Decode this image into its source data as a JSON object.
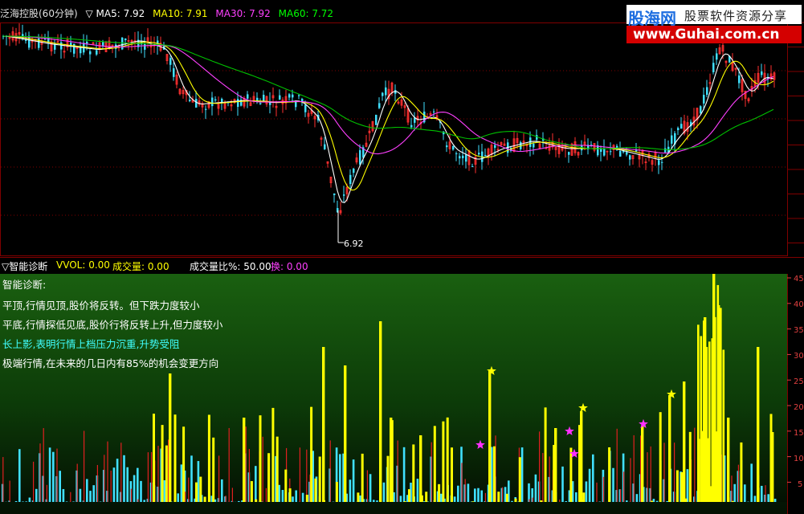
{
  "upper_panel": {
    "stock_name": "泛海控股(60分钟)",
    "indicators": [
      {
        "label": "▽ MA5: 7.92",
        "color": "#ffffff"
      },
      {
        "label": "MA10: 7.91",
        "color": "#ffff00"
      },
      {
        "label": "MA30: 7.92",
        "color": "#ff40ff"
      },
      {
        "label": "MA60: 7.72",
        "color": "#00ff00"
      }
    ],
    "low_marker": "6.92",
    "colors": {
      "up": "#ff3030",
      "down": "#40e0ff",
      "ma5": "#ffffff",
      "ma10": "#ffff00",
      "ma30": "#ff40ff",
      "ma60": "#00c000",
      "grid": "#800000"
    }
  },
  "lower_panel": {
    "items": [
      {
        "label": "▽智能诊断",
        "color": "#ffffff"
      },
      {
        "label": "VVOL: 0.00",
        "color": "#ffff00"
      },
      {
        "label": "成交量: 0.00",
        "color": "#ffff00"
      },
      {
        "label": "成交量比%: 50.00",
        "color": "#ffffff"
      },
      {
        "label": "换: 0.00",
        "color": "#ff40ff"
      }
    ],
    "diagnosis": [
      {
        "text": "智能诊断:",
        "color": "#ffffff"
      },
      {
        "text": "平顶,行情见顶,股价将反转。但下跌力度较小",
        "color": "#ffffff"
      },
      {
        "text": "平底,行情探低见底,股价行将反转上升,但力度较小",
        "color": "#ffffff"
      },
      {
        "text": "长上影,表明行情上档压力沉重,升势受阻",
        "color": "#40ffff"
      },
      {
        "text": "极端行情,在未来的几日内有85%的机会变更方向",
        "color": "#ffffff"
      }
    ],
    "y_axis_ticks": [
      "45",
      "40",
      "35",
      "30",
      "25",
      "20",
      "15",
      "10",
      "5"
    ],
    "colors": {
      "bar": "#ffff00",
      "cyan": "#40e0ff",
      "red": "#e02020",
      "star_yellow": "#ffff00",
      "star_magenta": "#ff30ff"
    }
  },
  "logo": {
    "brand": "股海网",
    "tagline": "股票软件资源分享",
    "url": "www.Guhai.com.cn"
  },
  "icons": [
    "chart-collapse-icon",
    "star-icon"
  ]
}
